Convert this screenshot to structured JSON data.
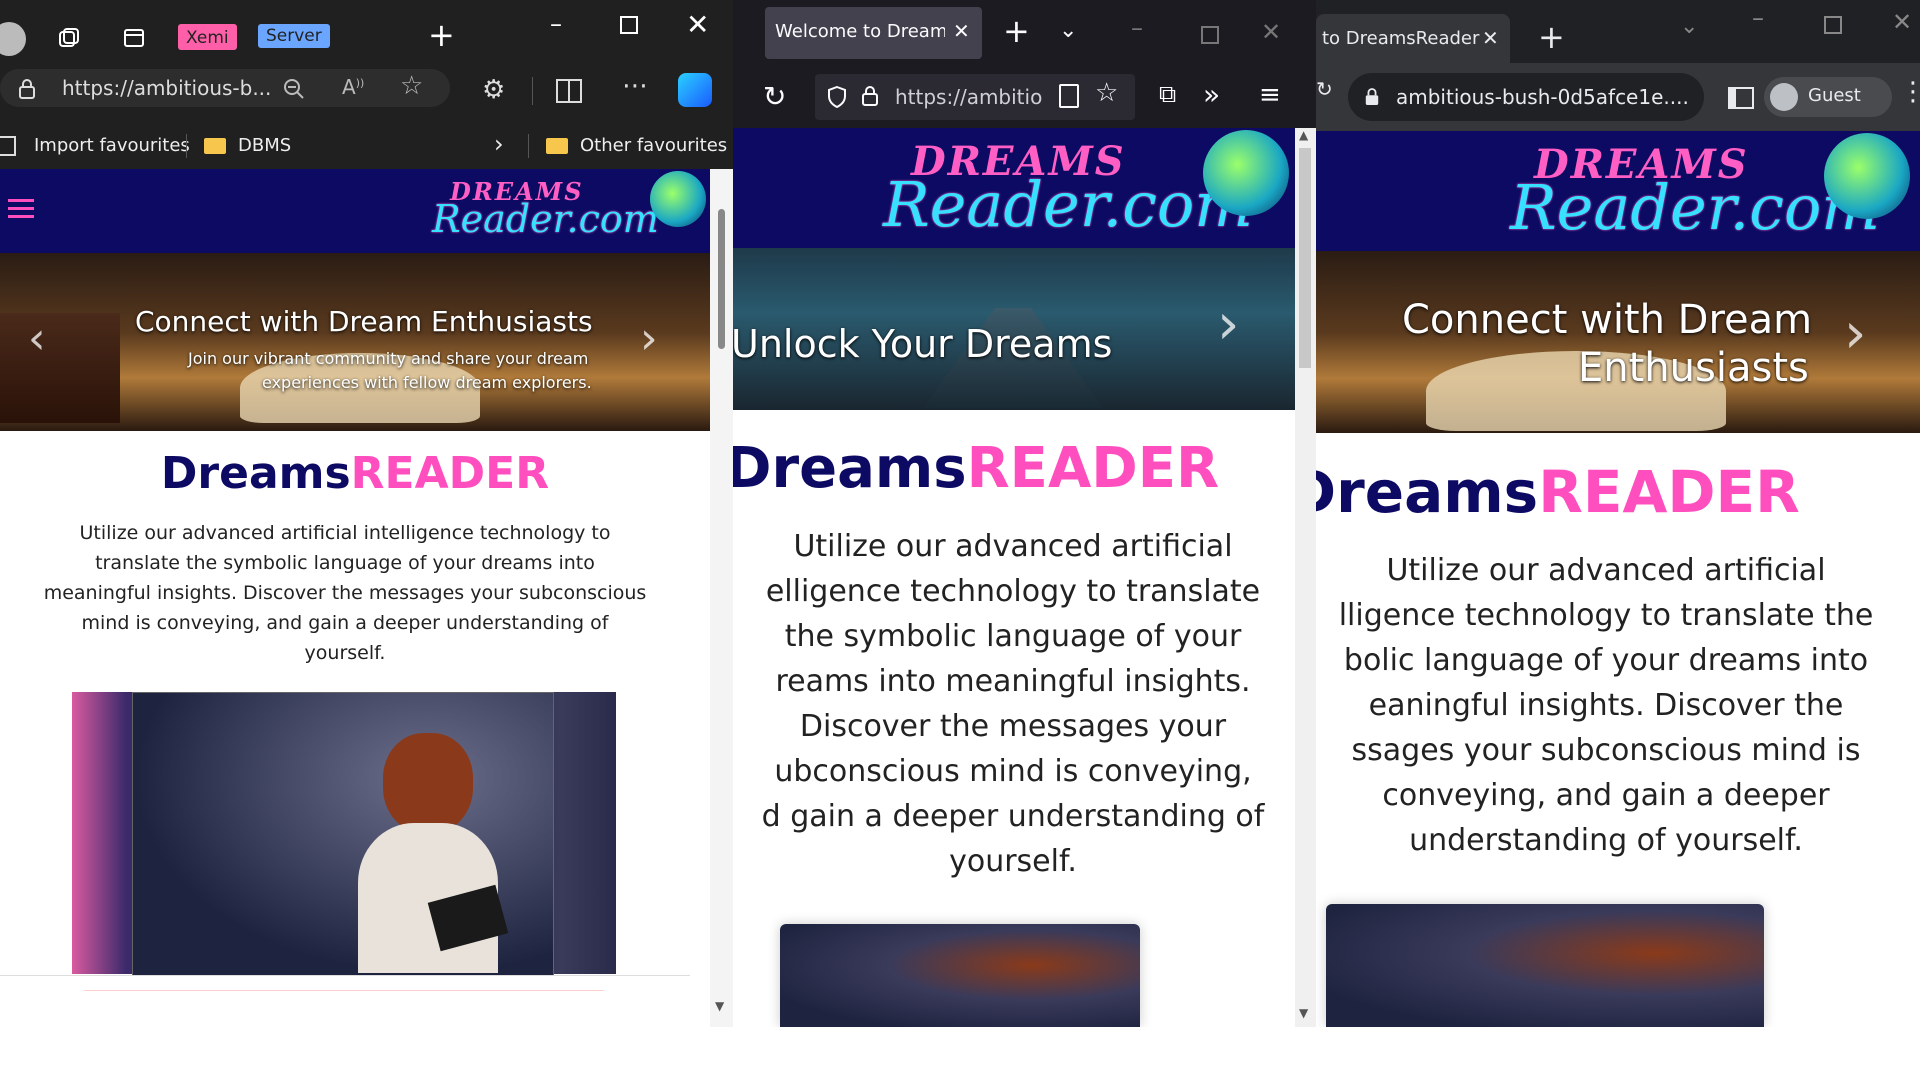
{
  "window1": {
    "browser": "Edge",
    "tab_groups": [
      "Xemi",
      "Server"
    ],
    "url": "https://ambitious-b...",
    "favourites": {
      "import": "Import favourites",
      "folder1": "DBMS",
      "other": "Other favourites"
    },
    "hero": {
      "title": "Connect with Dream Enthusiasts",
      "subtitle_line1": "Join our vibrant community and share your dream",
      "subtitle_line2": "experiences with fellow dream explorers."
    },
    "heading_dreams": "Dreams",
    "heading_reader": "READER",
    "para_lines": [
      "Utilize our advanced artificial intelligence technology to",
      "translate the symbolic language of your dreams into",
      "meaningful insights. Discover the messages your subconscious",
      "mind is conveying, and gain a deeper understanding of",
      "yourself."
    ]
  },
  "window2": {
    "browser": "Firefox",
    "tab_title": "Welcome to Dreams",
    "url": "https://ambitio",
    "hero": {
      "title": "Unlock Your Dreams"
    },
    "heading_dreams": "Dreams",
    "heading_reader": "READER",
    "para_lines": [
      "Utilize our advanced artificial",
      "elligence technology to translate",
      "the symbolic language of your",
      "reams into meaningful insights.",
      "Discover the messages your",
      "ubconscious mind is conveying,",
      "d gain a deeper understanding of",
      "yourself."
    ]
  },
  "window3": {
    "browser": "Chrome",
    "tab_title": "to DreamsReader",
    "url": "ambitious-bush-0d5afce1e....",
    "profile": "Guest",
    "hero": {
      "title_line1": "Connect with Dream",
      "title_line2": "Enthusiasts"
    },
    "heading_dreams": "Dreams",
    "heading_reader": "READER",
    "para_lines": [
      "Utilize our advanced artificial",
      "lligence technology to translate the",
      "bolic language of your dreams into",
      "eaningful insights. Discover the",
      "ssages your subconscious mind is",
      "conveying, and gain a deeper",
      "understanding of yourself."
    ]
  },
  "site": {
    "logo_top": "DREAMS",
    "logo_bottom": "Reader.com"
  },
  "colors": {
    "navy": "#0d0a63",
    "pink": "#ff4fbf",
    "cyan": "#38e0ff"
  }
}
